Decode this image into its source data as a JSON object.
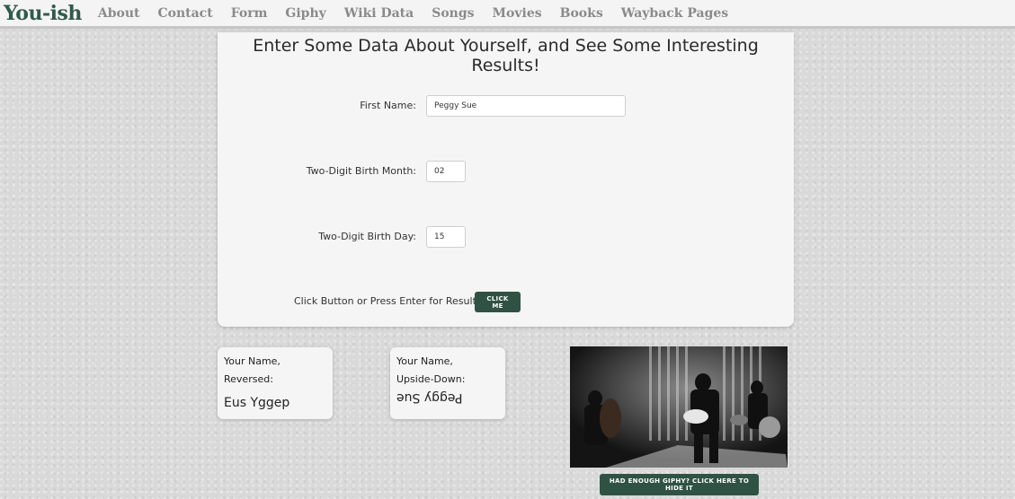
{
  "nav": {
    "brand": "You-ish",
    "links": [
      "About",
      "Contact",
      "Form",
      "Giphy",
      "Wiki Data",
      "Songs",
      "Movies",
      "Books",
      "Wayback Pages"
    ]
  },
  "form": {
    "title": "Enter Some Data About Yourself, and See Some Interesting Results!",
    "first_name_label": "First Name:",
    "first_name_value": "Peggy Sue",
    "birth_month_label": "Two-Digit Birth Month:",
    "birth_month_value": "02",
    "birth_day_label": "Two-Digit Birth Day:",
    "birth_day_value": "15",
    "submit_prompt": "Click Button or Press Enter for Results:",
    "submit_label": "CLICK ME"
  },
  "results": {
    "reversed_label": "Your Name, Reversed:",
    "reversed_value": "Eus Yggep",
    "upside_label_1": "Your Name,",
    "upside_label_2": "Upside-Down:",
    "upside_value": "Peggy Sue"
  },
  "giphy": {
    "hide_label": "HAD ENOUGH GIPHY? CLICK HERE TO HIDE IT"
  }
}
